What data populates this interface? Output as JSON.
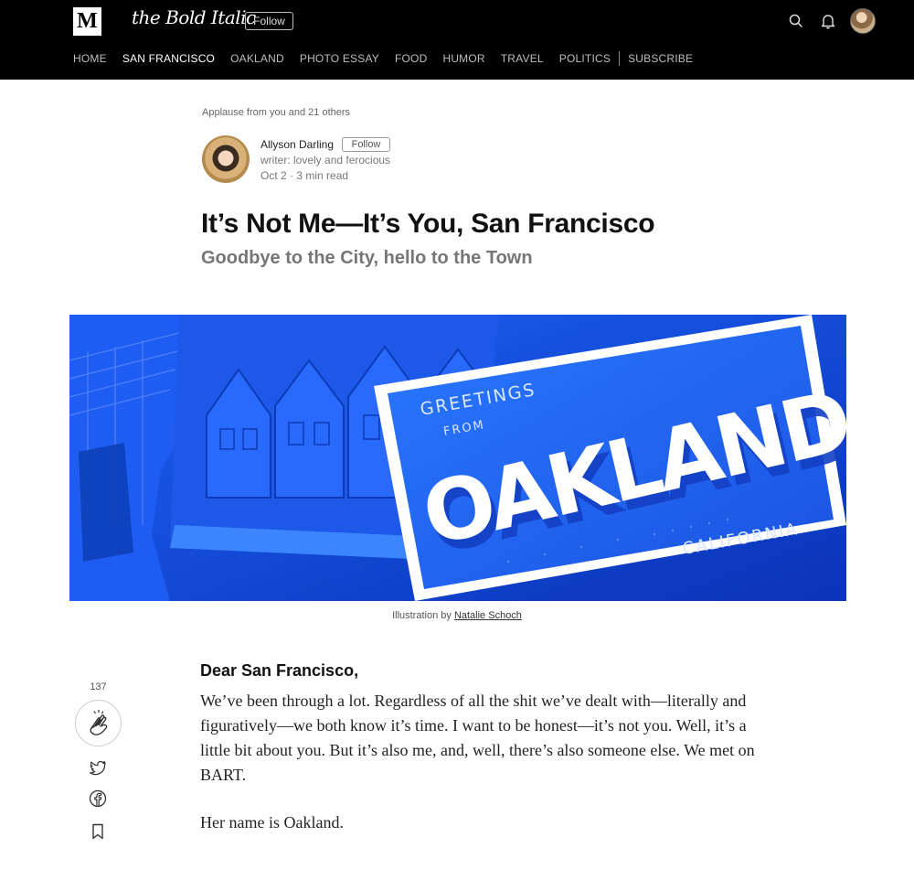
{
  "topbar": {
    "logo": "M",
    "publication": "the Bold Italic",
    "follow_label": "Follow",
    "icons": [
      "search-icon",
      "bell-icon",
      "avatar"
    ]
  },
  "nav": {
    "items": [
      {
        "label": "HOME"
      },
      {
        "label": "SAN FRANCISCO"
      },
      {
        "label": "OAKLAND"
      },
      {
        "label": "PHOTO ESSAY"
      },
      {
        "label": "FOOD"
      },
      {
        "label": "HUMOR"
      },
      {
        "label": "TRAVEL"
      },
      {
        "label": "POLITICS"
      },
      {
        "label": "SUBSCRIBE"
      }
    ],
    "active": "SAN FRANCISCO"
  },
  "article": {
    "applause": "Applause from you and 21 others",
    "author": {
      "name": "Allyson Darling",
      "follow_label": "Follow",
      "bio": "writer: lovely and ferocious",
      "meta": "Oct 2 · 3 min read"
    },
    "title": "It’s Not Me—It’s You, San Francisco",
    "subtitle": "Goodbye to the City, hello to the Town",
    "hero": {
      "greeting_line1": "GREETINGS",
      "greeting_line2": "FROM",
      "big_word": "OAKLAND",
      "state": "CALIFORNIA"
    },
    "caption": {
      "prefix": "Illustration by ",
      "artist": "Natalie Schoch"
    },
    "salutation": "Dear San Francisco,",
    "paragraph1": "We’ve been through a lot. Regardless of all the shit we’ve dealt with—literally and figuratively—we both know it’s time. I want to be honest—it’s not you. Well, it’s a little bit about you. But it’s also me, and, well, there’s also someone else. We met on BART.",
    "paragraph2": "Her name is Oakland."
  },
  "sidebar": {
    "clap_count": "137",
    "icons": [
      "clap-icon",
      "twitter-icon",
      "facebook-icon",
      "bookmark-icon"
    ]
  },
  "colors": {
    "topbar_bg": "#000000",
    "hero_blue": "#1a5cf0",
    "hero_dark": "#0b3bd0"
  }
}
